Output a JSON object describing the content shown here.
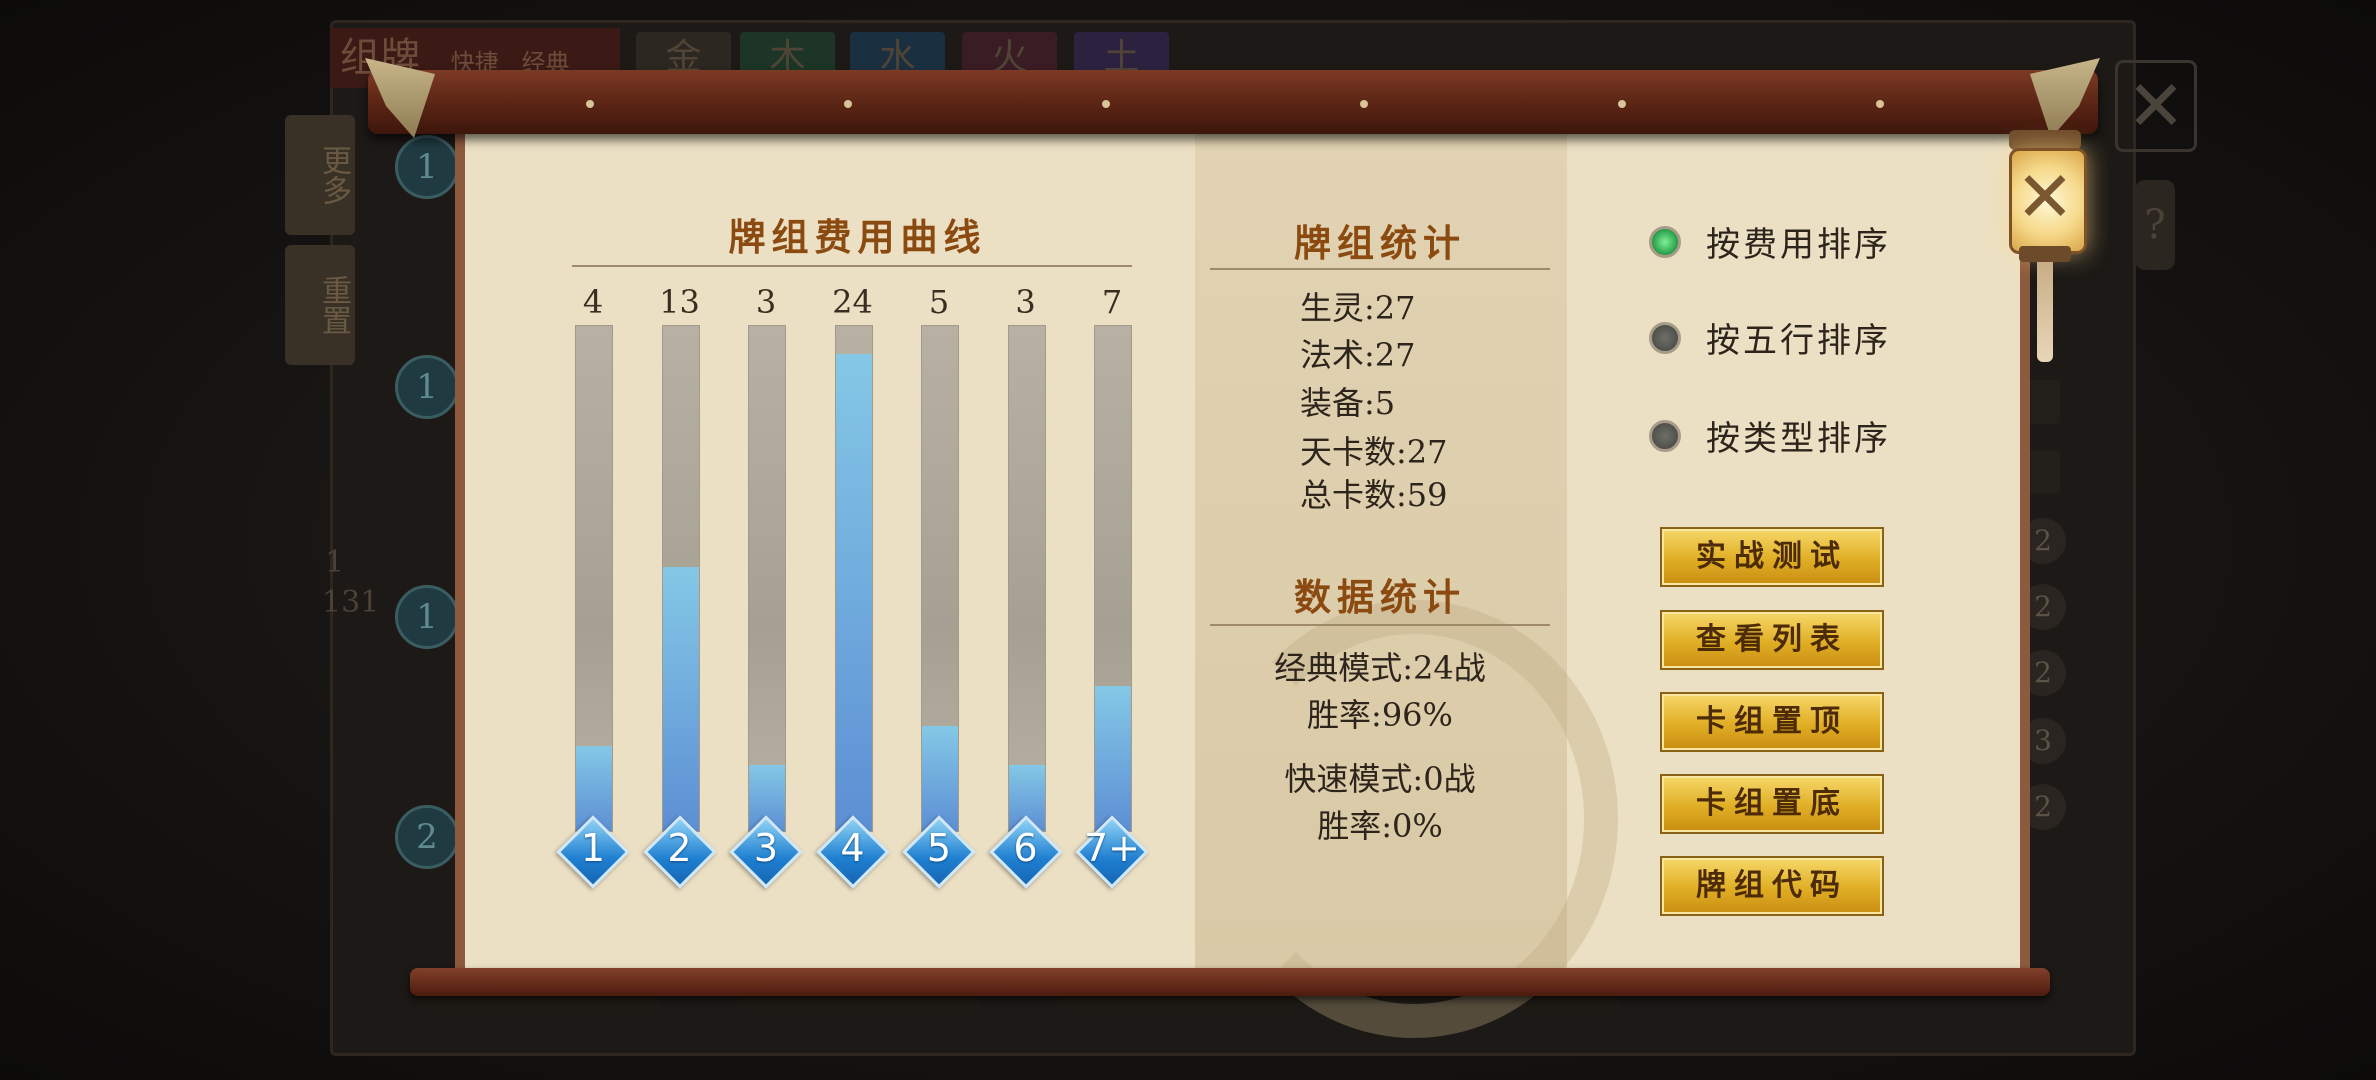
{
  "chart": {
    "title": "牌组费用曲线",
    "counts": [
      4,
      13,
      3,
      24,
      5,
      3,
      7
    ],
    "cost_labels": [
      "1",
      "2",
      "3",
      "4",
      "5",
      "6",
      "7+"
    ],
    "max": 24
  },
  "chart_data": {
    "type": "bar",
    "title": "牌组费用曲线",
    "categories": [
      "1",
      "2",
      "3",
      "4",
      "5",
      "6",
      "7+"
    ],
    "values": [
      4,
      13,
      3,
      24,
      5,
      3,
      7
    ],
    "ylim": [
      0,
      25
    ]
  },
  "deck_stats": {
    "title": "牌组统计",
    "creatures": "生灵:27",
    "spells": "法术:27",
    "equipment": "装备:5",
    "sky_cards": "天卡数:27",
    "total": "总卡数:59"
  },
  "data_stats": {
    "title": "数据统计",
    "classic_battles": "经典模式:24战",
    "classic_winrate": "胜率:96%",
    "quick_battles": "快速模式:0战",
    "quick_winrate": "胜率:0%"
  },
  "sort_options": [
    {
      "label": "按费用排序",
      "selected": true
    },
    {
      "label": "按五行排序",
      "selected": false
    },
    {
      "label": "按类型排序",
      "selected": false
    }
  ],
  "buttons": {
    "battle_test": "实战测试",
    "view_list": "查看列表",
    "pin_top": "卡组置顶",
    "pin_bottom": "卡组置底",
    "deck_code": "牌组代码"
  },
  "background": {
    "title": "组牌",
    "mode_tabs": [
      "快捷",
      "经典"
    ],
    "element_tabs": [
      "金",
      "木",
      "水",
      "火",
      "土"
    ],
    "side_tabs": [
      "更多",
      "重置"
    ],
    "page": "1",
    "page_total": "131",
    "cost_circles": [
      "1",
      "1",
      "1",
      "2"
    ],
    "row_numbers": [
      "2",
      "2",
      "2",
      "3",
      "2"
    ],
    "lantern_help": "?",
    "close_glyph": "✕",
    "colors": {
      "accent_gold": "#e0ae24",
      "bar_blue": "#5c8fd4",
      "title_brown": "#8b4a10"
    }
  },
  "close_icon_glyph": "✕"
}
